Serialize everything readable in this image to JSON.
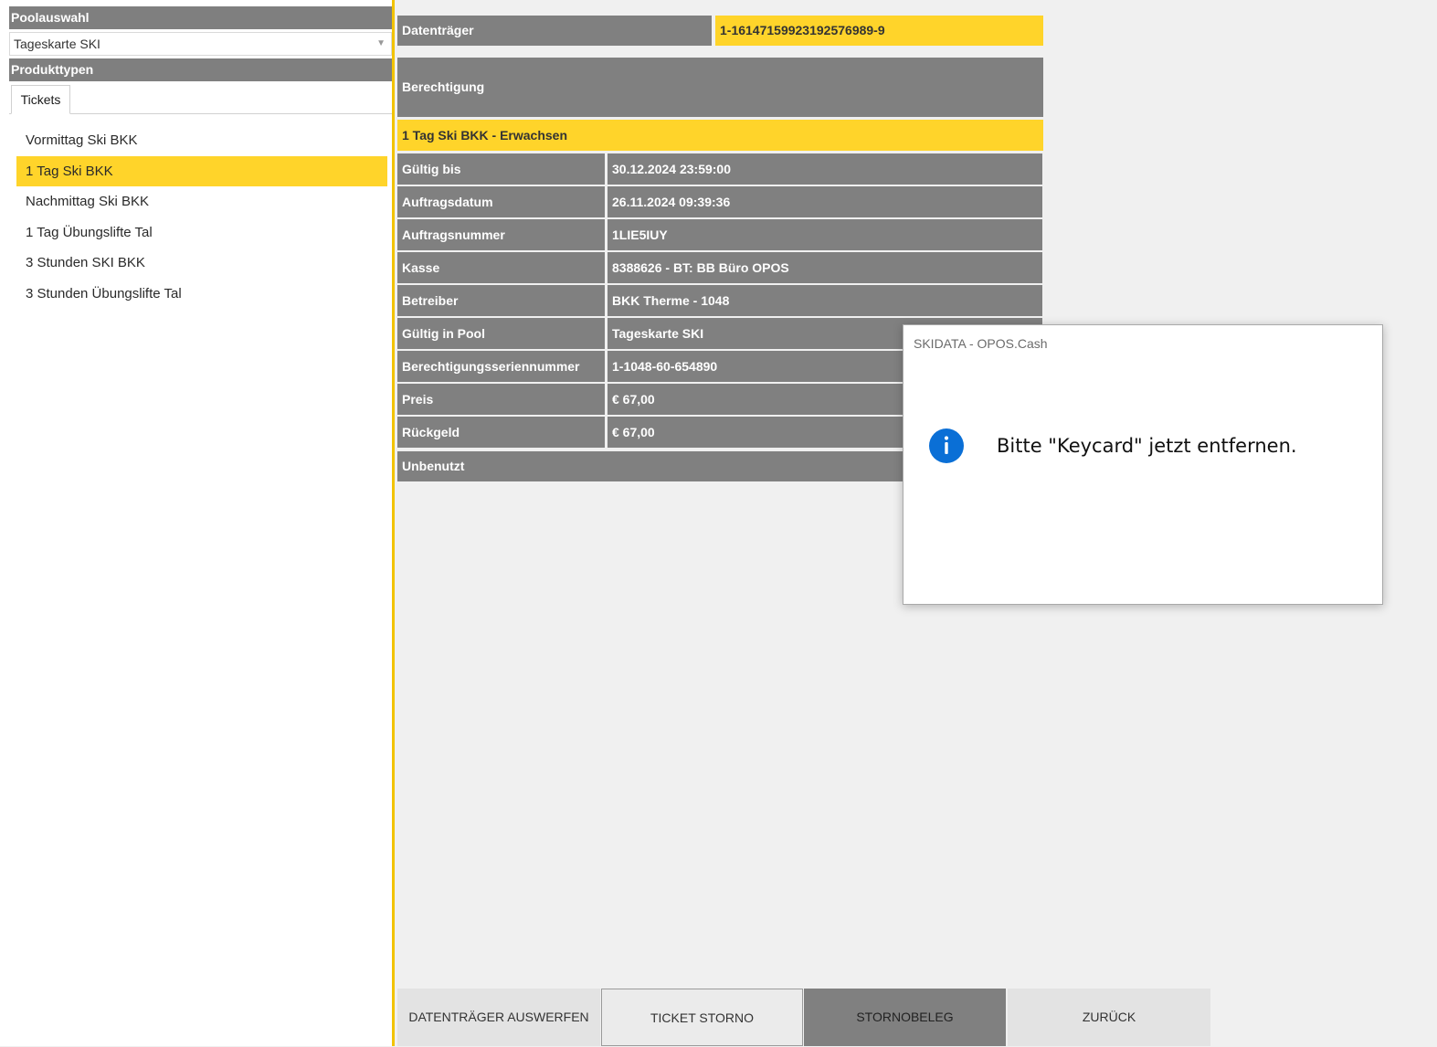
{
  "left": {
    "pool_header": "Poolauswahl",
    "pool_selected": "Tageskarte SKI",
    "product_types_header": "Produkttypen",
    "tab_label": "Tickets",
    "products": [
      "Vormittag Ski BKK",
      "1 Tag Ski BKK",
      "Nachmittag Ski BKK",
      "1 Tag Übungslifte Tal",
      "3 Stunden SKI BKK",
      "3 Stunden Übungslifte Tal"
    ],
    "selected_product_index": 1
  },
  "info": {
    "datentraeger_label": "Datenträger",
    "datentraeger_value": "1-16147159923192576989-9",
    "berechtigung_label": "Berechtigung",
    "ticket_name": "1 Tag Ski BKK - Erwachsen",
    "rows": [
      {
        "label": "Gültig bis",
        "value": "30.12.2024 23:59:00"
      },
      {
        "label": "Auftragsdatum",
        "value": "26.11.2024 09:39:36"
      },
      {
        "label": "Auftragsnummer",
        "value": "1LIE5IUY"
      },
      {
        "label": "Kasse",
        "value": "8388626 - BT: BB Büro OPOS"
      },
      {
        "label": "Betreiber",
        "value": "BKK Therme - 1048"
      },
      {
        "label": "Gültig in Pool",
        "value": "Tageskarte SKI"
      },
      {
        "label": "Berechtigungsseriennummer",
        "value": "1-1048-60-654890"
      },
      {
        "label": "Preis",
        "value": "€ 67,00"
      },
      {
        "label": "Rückgeld",
        "value": "€ 67,00"
      }
    ],
    "status": "Unbenutzt"
  },
  "buttons": {
    "eject": "DATENTRÄGER AUSWERFEN",
    "ticket_storno": "TICKET STORNO",
    "stornobeleg": "STORNOBELEG",
    "back": "ZURÜCK"
  },
  "dialog": {
    "title": "SKIDATA - OPOS.Cash",
    "icon": "info-icon",
    "message": "Bitte \"Keycard\" jetzt entfernen."
  },
  "colors": {
    "accent_yellow": "#ffd42a",
    "header_gray": "#808080",
    "info_blue": "#0a6fd6"
  }
}
